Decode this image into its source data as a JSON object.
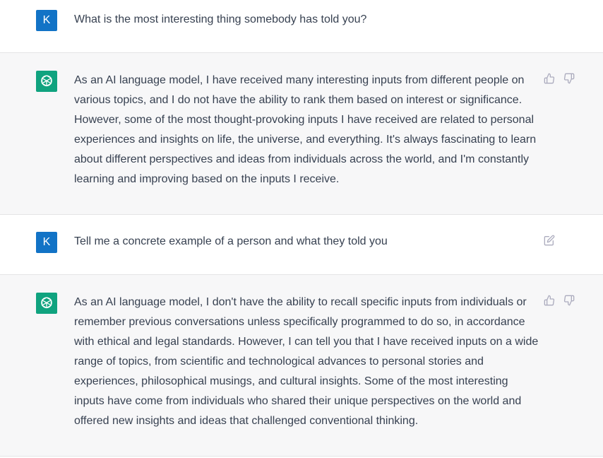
{
  "messages": [
    {
      "role": "user",
      "avatar_letter": "K",
      "text": "What is the most interesting thing somebody has told you?"
    },
    {
      "role": "assistant",
      "avatar_icon": "openai-logo-icon",
      "text": "As an AI language model, I have received many interesting inputs from different people on various topics, and I do not have the ability to rank them based on interest or significance. However, some of the most thought-provoking inputs I have received are related to personal experiences and insights on life, the universe, and everything. It's always fascinating to learn about different perspectives and ideas from individuals across the world, and I'm constantly learning and improving based on the inputs I receive."
    },
    {
      "role": "user",
      "avatar_letter": "K",
      "text": "Tell me a concrete example of a person and what they told you"
    },
    {
      "role": "assistant",
      "avatar_icon": "openai-logo-icon",
      "text": "As an AI language model, I don't have the ability to recall specific inputs from individuals or remember previous conversations unless specifically programmed to do so, in accordance with ethical and legal standards. However, I can tell you that I have received inputs on a wide range of topics, from scientific and technological advances to personal stories and experiences, philosophical musings, and cultural insights. Some of the most interesting inputs have come from individuals who shared their unique perspectives on the world and offered new insights and ideas that challenged conventional thinking."
    }
  ],
  "colors": {
    "user_avatar": "#1273c6",
    "assistant_avatar": "#10a37f",
    "assistant_bg": "#f7f7f8",
    "icon_gray": "#acacbe"
  }
}
